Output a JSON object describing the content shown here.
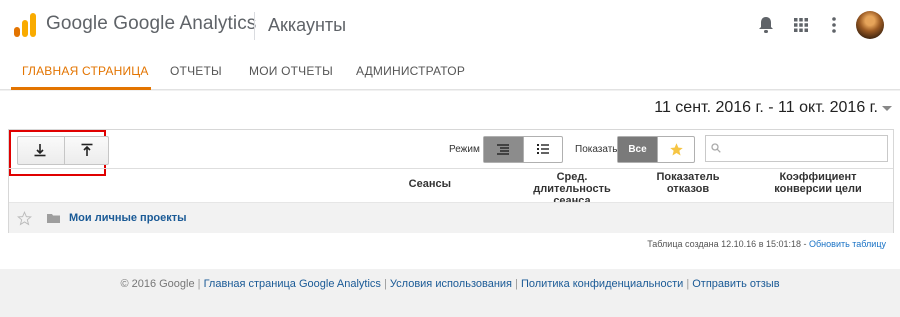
{
  "header": {
    "brand_google": "Google",
    "brand_product": "Google Analytics",
    "page_title": "Аккаунты",
    "icons": [
      "analytics-logo",
      "notifications-bell-icon",
      "apps-grid-icon",
      "more-vert-icon",
      "avatar"
    ]
  },
  "nav": {
    "items": [
      {
        "label": "ГЛАВНАЯ СТРАНИЦА",
        "active": true
      },
      {
        "label": "ОТЧЕТЫ"
      },
      {
        "label": "МОИ ОТЧЕТЫ"
      },
      {
        "label": "АДМИНИСТРАТОР"
      }
    ]
  },
  "date_range": "11 сент. 2016 г. - 11 окт. 2016 г.",
  "toolbar": {
    "import_icon": "download-icon",
    "export_icon": "upload-icon",
    "mode_label": "Режим",
    "show_label": "Показать",
    "show_all": "Все",
    "search_placeholder": ""
  },
  "table": {
    "columns": [
      "Сеансы",
      "Сред. длительность сеанса",
      "Показатель отказов",
      "Коэффициент конверсии цели"
    ],
    "rows": [
      {
        "label": "Мои личные проекты"
      }
    ]
  },
  "status": {
    "created_text": "Таблица создана 12.10.16 в 15:01:18 -",
    "refresh_link": "Обновить таблицу"
  },
  "footer": {
    "copyright": "© 2016 Google",
    "links": [
      "Главная страница Google Analytics",
      "Условия использования",
      "Политика конфиденциальности",
      "Отправить отзыв"
    ]
  },
  "colors": {
    "accent": "#e37400",
    "link": "#1a5a96",
    "highlight": "#e00000"
  }
}
